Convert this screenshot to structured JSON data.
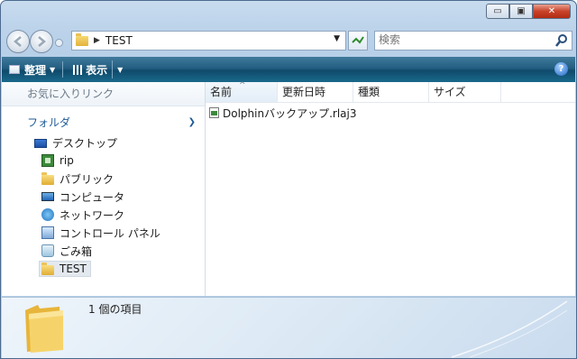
{
  "window": {
    "caption_buttons": [
      "minimize",
      "maximize",
      "close"
    ]
  },
  "address": {
    "path": [
      "TEST"
    ],
    "search_placeholder": "検索"
  },
  "toolbar": {
    "organize_label": "整理",
    "views_label": "表示"
  },
  "navpane": {
    "favorites_label": "お気に入りリンク",
    "folders_label": "フォルダ",
    "tree": [
      {
        "label": "デスクトップ",
        "icon": "desktop-icon",
        "level": 0
      },
      {
        "label": "rip",
        "icon": "user-folder-icon",
        "level": 1
      },
      {
        "label": "パブリック",
        "icon": "folder-icon",
        "level": 1
      },
      {
        "label": "コンピュータ",
        "icon": "computer-icon",
        "level": 1
      },
      {
        "label": "ネットワーク",
        "icon": "network-icon",
        "level": 1
      },
      {
        "label": "コントロール パネル",
        "icon": "control-panel-icon",
        "level": 1
      },
      {
        "label": "ごみ箱",
        "icon": "recycle-bin-icon",
        "level": 1
      },
      {
        "label": "TEST",
        "icon": "folder-icon",
        "level": 1,
        "selected": true
      }
    ]
  },
  "filelist": {
    "columns": [
      "名前",
      "更新日時",
      "種類",
      "サイズ"
    ],
    "files": [
      {
        "name": "Dolphinバックアップ.rlaj3"
      }
    ]
  },
  "details": {
    "count_text": "1 個の項目"
  }
}
